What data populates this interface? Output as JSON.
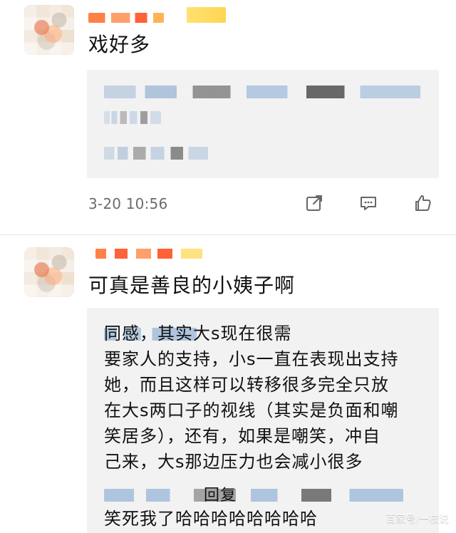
{
  "comments": [
    {
      "text": "戏好多",
      "timestamp": "3-20 10:56",
      "actions": {
        "share_icon": "share-icon",
        "comment_icon": "comment-icon",
        "like_icon": "like-icon"
      }
    },
    {
      "text": "可真是善良的小姨子啊",
      "quoted": {
        "text": "同感，其实大s现在很需\n要家人的支持，小s一直在表现出支持\n她，而且这样可以转移很多完全只放\n在大s两口子的视线（其实是负面和嘲\n笑居多），还有，如果是嘲笑，冲自\n己来，大s那边压力也会减小很多"
      },
      "reply": {
        "label": "回复",
        "text": "笑死我了哈哈哈哈哈哈哈哈"
      }
    }
  ],
  "watermark": "百家号/一枝说"
}
